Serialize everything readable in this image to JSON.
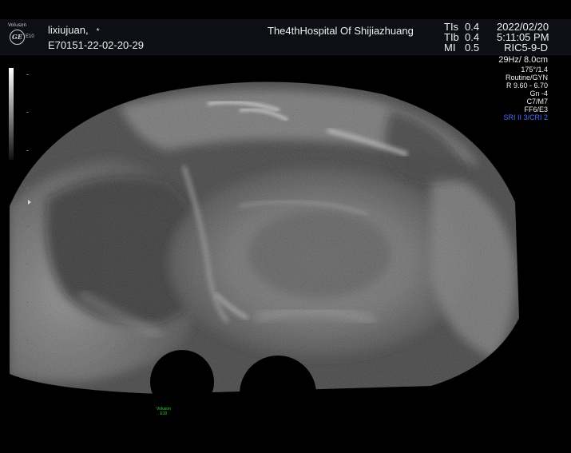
{
  "header": {
    "brand": "Voluson",
    "emblem": "GE",
    "model": "E10",
    "patient_name": "lixiujuan,",
    "patient_flag": "*",
    "exam_id": "E70151-22-02-20-29",
    "hospital": "The4thHospital Of Shijiazhuang",
    "acoustic": [
      {
        "label": "TIs",
        "value": "0.4"
      },
      {
        "label": "TIb",
        "value": "0.4"
      },
      {
        "label": "MI",
        "value": "0.5"
      }
    ],
    "date": "2022/02/20",
    "time": "5:11:05 PM",
    "probe": "RIC5-9-D"
  },
  "params": {
    "frame_depth": "29Hz/ 8.0cm",
    "angle": "175°/1.4",
    "preset": "Routine/GYN",
    "range": "R 9.60 - 6.70",
    "gain": "Gn  -4",
    "c_setting": "C7/M7",
    "f_setting": "FF6/E3",
    "sri": "SRI II 3/CRI 2"
  },
  "footer": {
    "brand": "Voluson",
    "model": "E10"
  },
  "colors": {
    "background": "#000000",
    "header_bg": "#0d0f14",
    "text": "#f0f0f0",
    "sri_text": "#4a6bff",
    "footer_logo": "#3ad23a"
  }
}
